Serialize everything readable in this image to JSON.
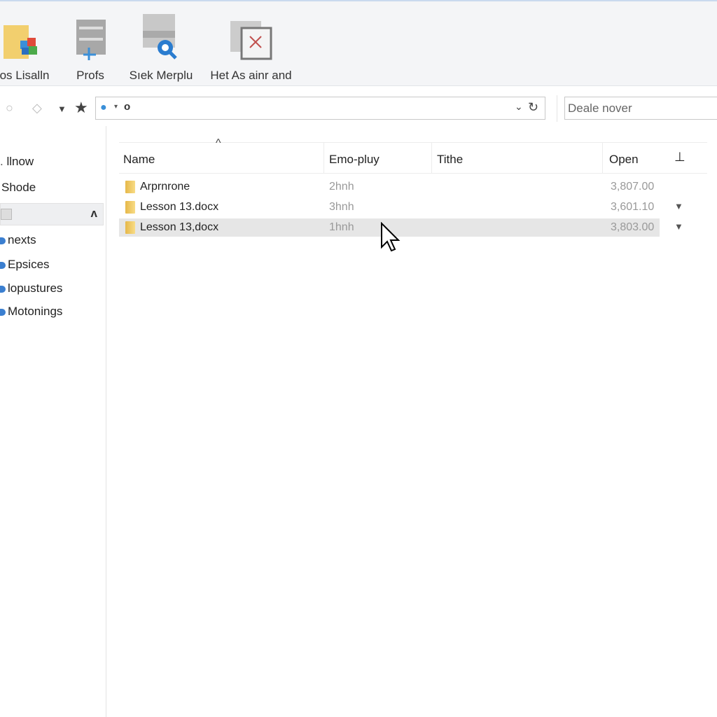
{
  "ribbon": {
    "buttons": [
      {
        "label": "os Lisalln",
        "icon": "folder-apps-icon"
      },
      {
        "label": "Profs",
        "icon": "server-add-icon"
      },
      {
        "label": "Sıek Merplu",
        "icon": "search-drive-icon"
      },
      {
        "label": "Het As ainr and",
        "icon": "window-close-icon"
      }
    ]
  },
  "address": {
    "value": "",
    "icons": [
      "back-icon",
      "forward-icon",
      "dropdown-icon",
      "star-icon",
      "network-icon",
      "refresh-icon"
    ]
  },
  "search": {
    "placeholder": "Deale nover"
  },
  "sidebar": {
    "items": [
      {
        "label": "llnow"
      },
      {
        "label": "Shode"
      },
      {
        "label": "nexts"
      },
      {
        "label": "Epsices"
      },
      {
        "label": "lopustures"
      },
      {
        "label": "Motonings"
      }
    ]
  },
  "table": {
    "columns": [
      "Name",
      "Emo-pluy",
      "Tithe",
      "Open"
    ],
    "sort_column": "Name",
    "rows": [
      {
        "name": "Arprnrone",
        "col2": "2hnh",
        "col3": "",
        "open": "3,807.00",
        "selected": false
      },
      {
        "name": "Lesson 13.docx",
        "col2": "3hnh",
        "col3": "",
        "open": "3,601.10",
        "selected": false
      },
      {
        "name": "Lesson 13,docx",
        "col2": "1hnh",
        "col3": "",
        "open": "3,803.00",
        "selected": true
      }
    ]
  },
  "colors": {
    "accent": "#2f7fd1",
    "folder": "#f0c860",
    "selection": "#e6e6e6"
  }
}
